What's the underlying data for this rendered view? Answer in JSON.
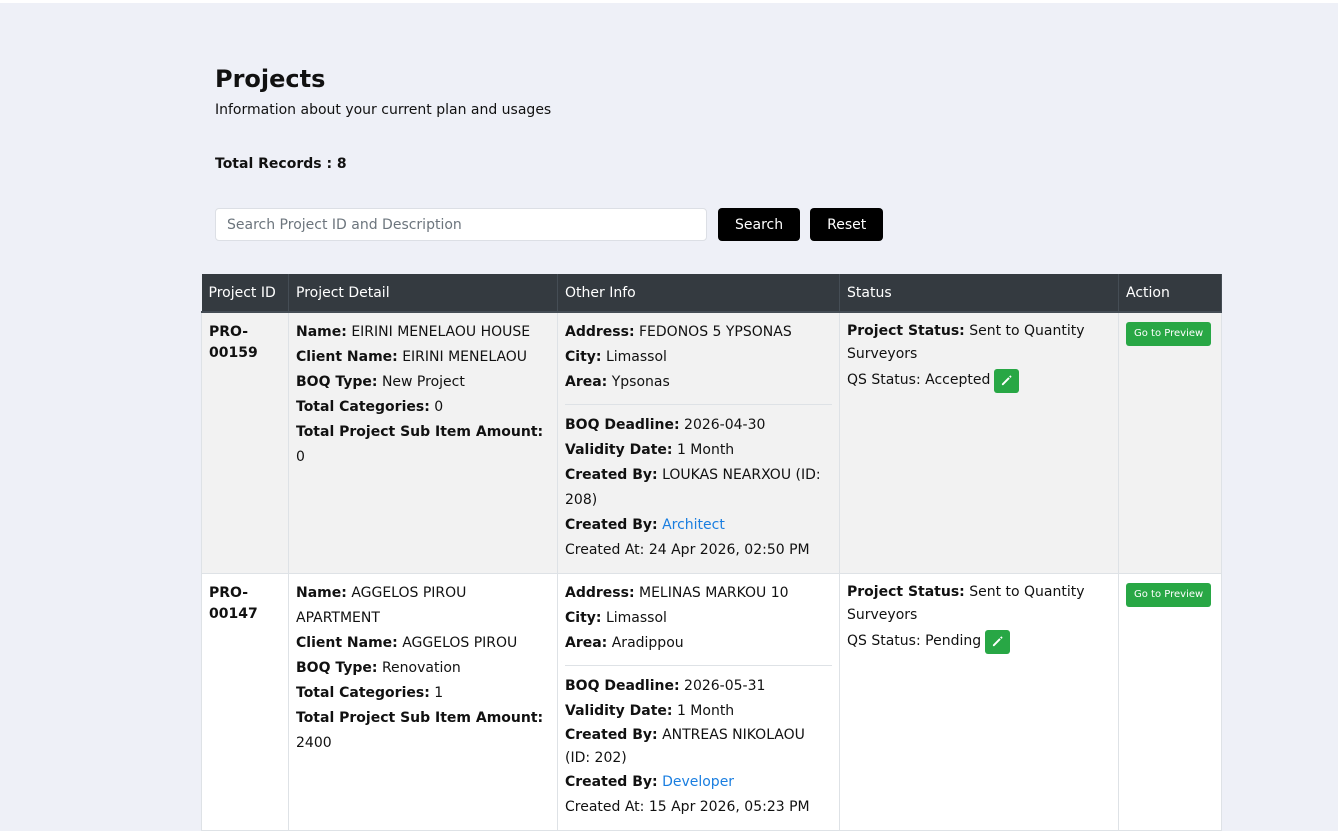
{
  "page": {
    "title": "Projects",
    "subtitle": "Information about your current plan and usages",
    "total_label": "Total Records : 8"
  },
  "search": {
    "placeholder": "Search Project ID and Description",
    "value": "",
    "search_label": "Search",
    "reset_label": "Reset"
  },
  "table": {
    "headers": [
      "Project ID",
      "Project Detail",
      "Other Info",
      "Status",
      "Action"
    ],
    "labels": {
      "name": "Name:",
      "client_name": "Client Name:",
      "boq_type": "BOQ Type:",
      "total_categories": "Total Categories:",
      "total_sub_item": "Total Project Sub Item Amount:",
      "address": "Address:",
      "city": "City:",
      "area": "Area:",
      "boq_deadline": "BOQ Deadline:",
      "validity_date": "Validity Date:",
      "created_by": "Created By:",
      "project_status": "Project Status:",
      "action": "Go to Preview"
    },
    "rows": [
      {
        "project_id": "PRO-00159",
        "name": "EIRINI MENELAOU HOUSE",
        "client_name": "EIRINI MENELAOU",
        "boq_type": "New Project",
        "total_categories": "0",
        "total_sub_item": "0",
        "address": "FEDONOS 5 YPSONAS",
        "city": "Limassol",
        "area": "Ypsonas",
        "boq_deadline": "2026-04-30",
        "validity_date": "1 Month",
        "created_by": "LOUKAS NEARXOU (ID: 208)",
        "created_by_role": "Architect",
        "created_at": "Created At: 24 Apr 2026, 02:50 PM",
        "project_status": "Sent to Quantity Surveyors",
        "qs_status": "QS Status: Accepted"
      },
      {
        "project_id": "PRO-00147",
        "name": "AGGELOS PIROU APARTMENT",
        "client_name": "AGGELOS PIROU",
        "boq_type": "Renovation",
        "total_categories": "1",
        "total_sub_item": "2400",
        "address": "MELINAS MARKOU 10",
        "city": "Limassol",
        "area": "Aradippou",
        "boq_deadline": "2026-05-31",
        "validity_date": "1 Month",
        "created_by": "ANTREAS NIKOLAOU (ID: 202)",
        "created_by_role": "Developer",
        "created_at": "Created At: 15 Apr 2026, 05:23 PM",
        "project_status": "Sent to Quantity Surveyors",
        "qs_status": "QS Status: Pending"
      }
    ]
  },
  "colors": {
    "page_bg": "#eef0f7",
    "header_bg": "#343a40",
    "accent_green": "#28a745",
    "link_blue": "#1a7ee0"
  },
  "icons": {
    "edit": "pencil-icon"
  }
}
